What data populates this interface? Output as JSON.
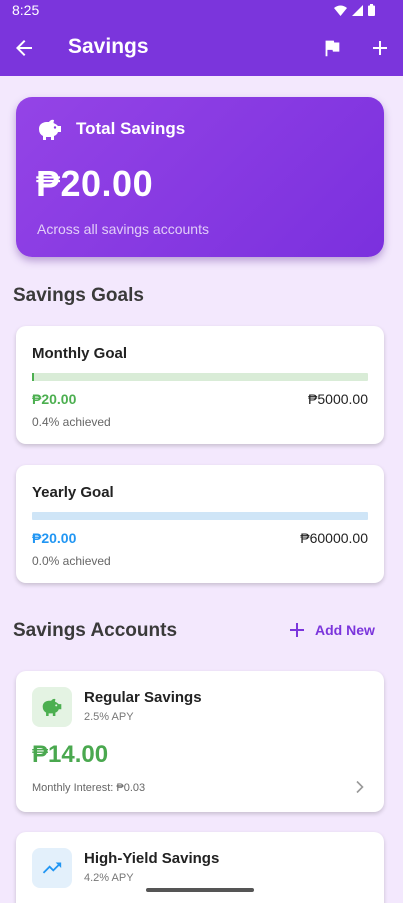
{
  "status_bar": {
    "time": "8:25"
  },
  "app_bar": {
    "title": "Savings"
  },
  "total": {
    "label": "Total Savings",
    "amount": "₱20.00",
    "subtitle": "Across all savings accounts"
  },
  "goals": {
    "section_title": "Savings Goals",
    "items": [
      {
        "title": "Monthly Goal",
        "current": "₱20.00",
        "target": "₱5000.00",
        "achieved": "0.4% achieved",
        "progress": 0.004,
        "color": "#4caf50",
        "track_color": "#d9ecd7"
      },
      {
        "title": "Yearly Goal",
        "current": "₱20.00",
        "target": "₱60000.00",
        "achieved": "0.0% achieved",
        "progress": 0.0,
        "color": "#2196f3",
        "track_color": "#cfe5f7"
      }
    ]
  },
  "accounts": {
    "section_title": "Savings Accounts",
    "add_label": "Add New",
    "items": [
      {
        "name": "Regular Savings",
        "apy": "2.5% APY",
        "balance": "₱14.00",
        "interest": "Monthly Interest: ₱0.03",
        "icon": "piggy-bank-icon",
        "badge_color": "#e4f3e3",
        "icon_color": "#4caf50"
      },
      {
        "name": "High-Yield Savings",
        "apy": "4.2% APY",
        "icon": "trending-up-icon",
        "badge_color": "#e3f0fb",
        "icon_color": "#2196f3"
      }
    ]
  },
  "colors": {
    "primary": "#7b35dc",
    "background": "#f3e8fd",
    "positive": "#4caf50"
  }
}
